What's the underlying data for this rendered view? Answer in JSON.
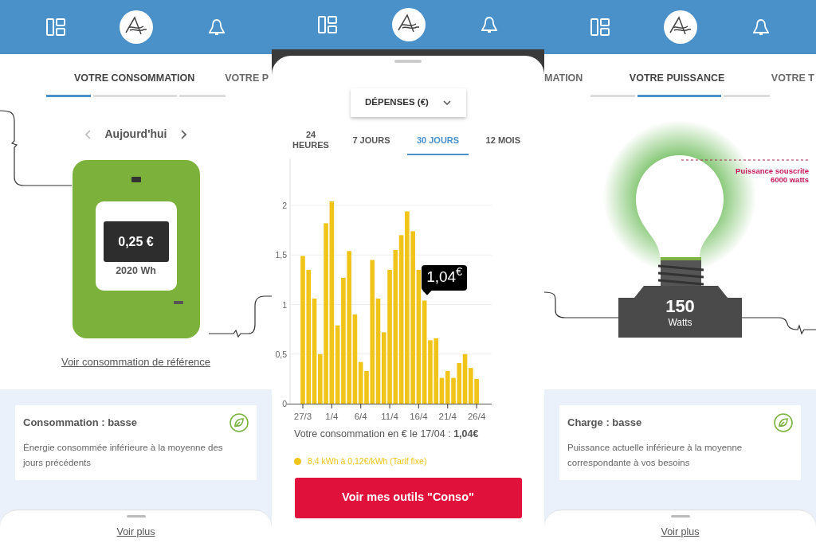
{
  "panels": [
    {
      "kind": "meter",
      "tabs": [
        {
          "label": "VOTRE CONSOMMATION",
          "selected": true
        },
        {
          "label": "VOTRE P",
          "selected": false
        }
      ],
      "period": "Aujourd'hui",
      "meter_value": "0,25 €",
      "meter_energy": "2020 Wh",
      "link": "Voir consommation de référence",
      "card": {
        "title": "Consommation : basse",
        "text": "Énergie consommée inférieure à la moyenne des jours précédents"
      },
      "more": "Voir plus"
    },
    {
      "kind": "chart",
      "dropdown": "DÉPENSES (€)",
      "tabs": [
        {
          "label": "24 HEURES",
          "selected": false
        },
        {
          "label": "7 JOURS",
          "selected": false
        },
        {
          "label": "30 JOURS",
          "selected": true
        },
        {
          "label": "12 MOIS",
          "selected": false
        }
      ],
      "chart_data": {
        "type": "bar",
        "categories": [
          "27/3",
          null,
          null,
          null,
          null,
          "1/4",
          null,
          null,
          null,
          null,
          "6/4",
          null,
          null,
          null,
          null,
          "11/4",
          null,
          null,
          null,
          null,
          "16/4",
          null,
          null,
          null,
          null,
          "21/4",
          null,
          null,
          null,
          null,
          "26/4"
        ],
        "series": [
          {
            "color": "#f0c419",
            "values": [
              1.49,
              1.35,
              1.06,
              0.5,
              1.82,
              2.04,
              0.79,
              1.27,
              1.54,
              0.9,
              0.42,
              0.33,
              1.45,
              1.06,
              0.72,
              1.35,
              1.55,
              1.7,
              1.94,
              1.74,
              1.35,
              1.04,
              0.64,
              0.66,
              0.26,
              0.33,
              0.26,
              0.41,
              0.5,
              0.36,
              0.25
            ]
          }
        ],
        "ylim": [
          0,
          2.47
        ],
        "yticks": [
          0,
          {
            "value": 0.5,
            "label": "0,5"
          },
          1,
          {
            "value": 1.5,
            "label": "1,5"
          },
          2
        ],
        "grid": true,
        "annotations": [
          {
            "text": "1,04$^{€}$"
          }
        ]
      },
      "summary": "Votre consommation en € le 17/04 : **1,04€**",
      "legend": {
        "text": "8,4 kWh à 0,12€/kWh (Tarif fixe)",
        "color": "#f0c419"
      },
      "button": "Voir mes outils \"Conso\""
    },
    {
      "kind": "power",
      "tabs": [
        {
          "label": "MATION",
          "selected": false
        },
        {
          "label": "VOTRE PUISSANCE",
          "selected": true
        },
        {
          "label": "VOTRE T",
          "selected": false
        }
      ],
      "limit_label": "Puissance souscrite",
      "limit_value": "6000 watts",
      "power_value": "150",
      "power_unit": "Watts",
      "card": {
        "title": "Charge : basse",
        "text": "Puissance actuelle inférieure à la moyenne correspondante à vos besoins"
      },
      "more": "Voir plus"
    }
  ]
}
